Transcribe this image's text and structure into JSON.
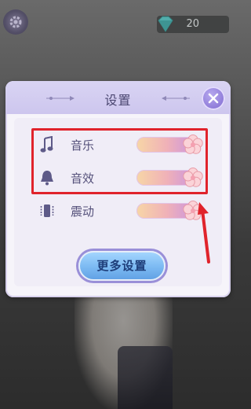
{
  "currency": {
    "icon": "gem-icon",
    "value": "20"
  },
  "dialog": {
    "title": "设置",
    "close_icon": "close-icon",
    "settings": [
      {
        "key": "music",
        "icon": "music-note-icon",
        "label": "音乐",
        "level": 1.0
      },
      {
        "key": "sound",
        "icon": "bell-icon",
        "label": "音效",
        "level": 1.0
      },
      {
        "key": "vibrate",
        "icon": "vibration-icon",
        "label": "震动",
        "level": 1.0
      }
    ],
    "more_button": "更多设置"
  },
  "colors": {
    "accent_purple": "#8d79d8",
    "highlight_red": "#e0232b",
    "button_blue": "#7bb9f2"
  }
}
